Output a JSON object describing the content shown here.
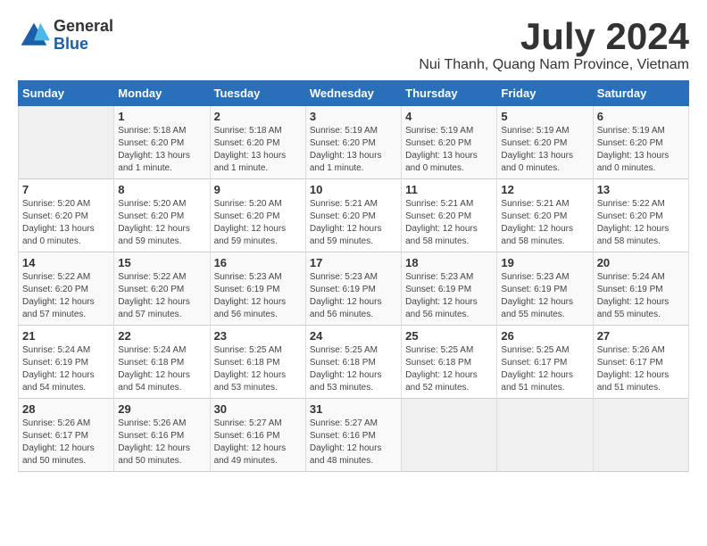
{
  "header": {
    "logo": {
      "line1": "General",
      "line2": "Blue"
    },
    "month": "July 2024",
    "location": "Nui Thanh, Quang Nam Province, Vietnam"
  },
  "weekdays": [
    "Sunday",
    "Monday",
    "Tuesday",
    "Wednesday",
    "Thursday",
    "Friday",
    "Saturday"
  ],
  "weeks": [
    [
      {
        "day": "",
        "info": ""
      },
      {
        "day": "1",
        "info": "Sunrise: 5:18 AM\nSunset: 6:20 PM\nDaylight: 13 hours\nand 1 minute."
      },
      {
        "day": "2",
        "info": "Sunrise: 5:18 AM\nSunset: 6:20 PM\nDaylight: 13 hours\nand 1 minute."
      },
      {
        "day": "3",
        "info": "Sunrise: 5:19 AM\nSunset: 6:20 PM\nDaylight: 13 hours\nand 1 minute."
      },
      {
        "day": "4",
        "info": "Sunrise: 5:19 AM\nSunset: 6:20 PM\nDaylight: 13 hours\nand 0 minutes."
      },
      {
        "day": "5",
        "info": "Sunrise: 5:19 AM\nSunset: 6:20 PM\nDaylight: 13 hours\nand 0 minutes."
      },
      {
        "day": "6",
        "info": "Sunrise: 5:19 AM\nSunset: 6:20 PM\nDaylight: 13 hours\nand 0 minutes."
      }
    ],
    [
      {
        "day": "7",
        "info": "Sunrise: 5:20 AM\nSunset: 6:20 PM\nDaylight: 13 hours\nand 0 minutes."
      },
      {
        "day": "8",
        "info": "Sunrise: 5:20 AM\nSunset: 6:20 PM\nDaylight: 12 hours\nand 59 minutes."
      },
      {
        "day": "9",
        "info": "Sunrise: 5:20 AM\nSunset: 6:20 PM\nDaylight: 12 hours\nand 59 minutes."
      },
      {
        "day": "10",
        "info": "Sunrise: 5:21 AM\nSunset: 6:20 PM\nDaylight: 12 hours\nand 59 minutes."
      },
      {
        "day": "11",
        "info": "Sunrise: 5:21 AM\nSunset: 6:20 PM\nDaylight: 12 hours\nand 58 minutes."
      },
      {
        "day": "12",
        "info": "Sunrise: 5:21 AM\nSunset: 6:20 PM\nDaylight: 12 hours\nand 58 minutes."
      },
      {
        "day": "13",
        "info": "Sunrise: 5:22 AM\nSunset: 6:20 PM\nDaylight: 12 hours\nand 58 minutes."
      }
    ],
    [
      {
        "day": "14",
        "info": "Sunrise: 5:22 AM\nSunset: 6:20 PM\nDaylight: 12 hours\nand 57 minutes."
      },
      {
        "day": "15",
        "info": "Sunrise: 5:22 AM\nSunset: 6:20 PM\nDaylight: 12 hours\nand 57 minutes."
      },
      {
        "day": "16",
        "info": "Sunrise: 5:23 AM\nSunset: 6:19 PM\nDaylight: 12 hours\nand 56 minutes."
      },
      {
        "day": "17",
        "info": "Sunrise: 5:23 AM\nSunset: 6:19 PM\nDaylight: 12 hours\nand 56 minutes."
      },
      {
        "day": "18",
        "info": "Sunrise: 5:23 AM\nSunset: 6:19 PM\nDaylight: 12 hours\nand 56 minutes."
      },
      {
        "day": "19",
        "info": "Sunrise: 5:23 AM\nSunset: 6:19 PM\nDaylight: 12 hours\nand 55 minutes."
      },
      {
        "day": "20",
        "info": "Sunrise: 5:24 AM\nSunset: 6:19 PM\nDaylight: 12 hours\nand 55 minutes."
      }
    ],
    [
      {
        "day": "21",
        "info": "Sunrise: 5:24 AM\nSunset: 6:19 PM\nDaylight: 12 hours\nand 54 minutes."
      },
      {
        "day": "22",
        "info": "Sunrise: 5:24 AM\nSunset: 6:18 PM\nDaylight: 12 hours\nand 54 minutes."
      },
      {
        "day": "23",
        "info": "Sunrise: 5:25 AM\nSunset: 6:18 PM\nDaylight: 12 hours\nand 53 minutes."
      },
      {
        "day": "24",
        "info": "Sunrise: 5:25 AM\nSunset: 6:18 PM\nDaylight: 12 hours\nand 53 minutes."
      },
      {
        "day": "25",
        "info": "Sunrise: 5:25 AM\nSunset: 6:18 PM\nDaylight: 12 hours\nand 52 minutes."
      },
      {
        "day": "26",
        "info": "Sunrise: 5:25 AM\nSunset: 6:17 PM\nDaylight: 12 hours\nand 51 minutes."
      },
      {
        "day": "27",
        "info": "Sunrise: 5:26 AM\nSunset: 6:17 PM\nDaylight: 12 hours\nand 51 minutes."
      }
    ],
    [
      {
        "day": "28",
        "info": "Sunrise: 5:26 AM\nSunset: 6:17 PM\nDaylight: 12 hours\nand 50 minutes."
      },
      {
        "day": "29",
        "info": "Sunrise: 5:26 AM\nSunset: 6:16 PM\nDaylight: 12 hours\nand 50 minutes."
      },
      {
        "day": "30",
        "info": "Sunrise: 5:27 AM\nSunset: 6:16 PM\nDaylight: 12 hours\nand 49 minutes."
      },
      {
        "day": "31",
        "info": "Sunrise: 5:27 AM\nSunset: 6:16 PM\nDaylight: 12 hours\nand 48 minutes."
      },
      {
        "day": "",
        "info": ""
      },
      {
        "day": "",
        "info": ""
      },
      {
        "day": "",
        "info": ""
      }
    ]
  ]
}
